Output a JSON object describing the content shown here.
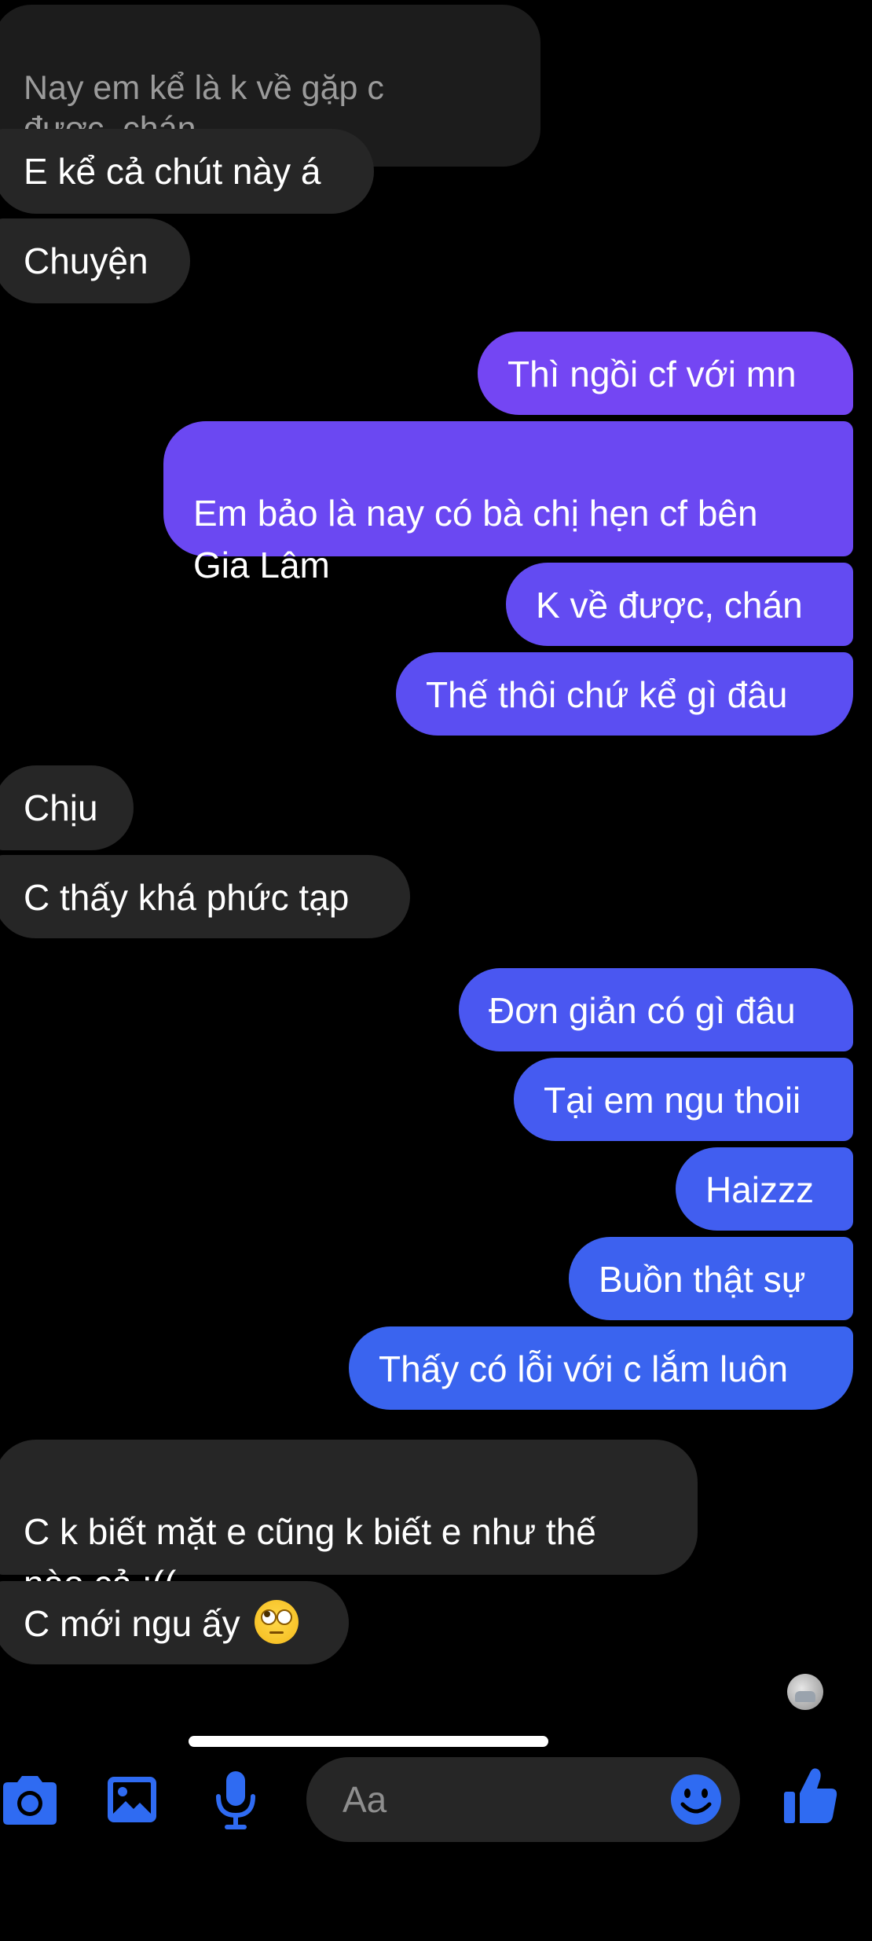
{
  "colors": {
    "background": "#000000",
    "incoming_bubble": "#262626",
    "outgoing_gradient_top": "#7646f2",
    "outgoing_gradient_bottom": "#3d64ef",
    "accent_blue": "#2f6bf2"
  },
  "messages": [
    {
      "side": "in",
      "text": "Nay em kể là k về gặp c\nđược, chán",
      "quoted": true
    },
    {
      "side": "in",
      "text": "E kể cả chút này á"
    },
    {
      "side": "in",
      "text": "Chuyện"
    },
    {
      "side": "out",
      "text": "Thì ngồi cf với mn"
    },
    {
      "side": "out",
      "text": "Em bảo là nay có bà chị hẹn cf bên\nGia Lâm"
    },
    {
      "side": "out",
      "text": "K về được, chán"
    },
    {
      "side": "out",
      "text": "Thế thôi chứ kể gì đâu"
    },
    {
      "side": "in",
      "text": "Chịu"
    },
    {
      "side": "in",
      "text": "C thấy khá phức tạp"
    },
    {
      "side": "out",
      "text": "Đơn giản có gì đâu"
    },
    {
      "side": "out",
      "text": "Tại em ngu thoii"
    },
    {
      "side": "out",
      "text": "Haizzz"
    },
    {
      "side": "out",
      "text": "Buồn thật sự"
    },
    {
      "side": "out",
      "text": "Thấy có lỗi với c lắm luôn"
    },
    {
      "side": "in",
      "text": "C k biết mặt e cũng k biết e như thế\nnào cả :(("
    },
    {
      "side": "in",
      "text": "C mới ngu ấy",
      "emoji": "face-with-rolling-eyes"
    }
  ],
  "composer": {
    "placeholder": "Aa",
    "icons": [
      "camera-icon",
      "gallery-icon",
      "microphone-icon",
      "emoji-icon",
      "thumbs-up-icon"
    ]
  }
}
